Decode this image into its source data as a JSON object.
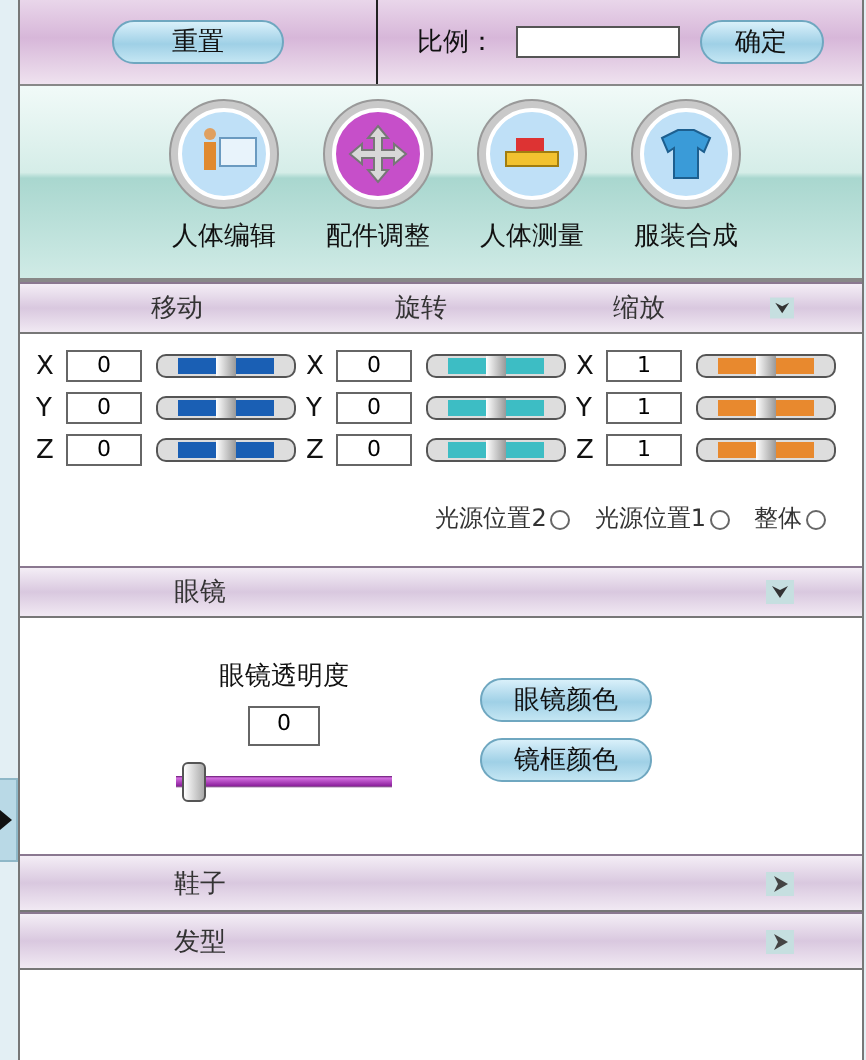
{
  "top_bar": {
    "reset_button": "重置",
    "scale_label": "比例：",
    "confirm_button": "确定"
  },
  "tools": [
    {
      "label": "人体编辑",
      "kind": "person",
      "selected": false
    },
    {
      "label": "配件调整",
      "kind": "move",
      "selected": true
    },
    {
      "label": "人体测量",
      "kind": "ruler",
      "selected": false
    },
    {
      "label": "服装合成",
      "kind": "shirt",
      "selected": false
    }
  ],
  "transform": {
    "expanded": true,
    "groups": [
      {
        "title": "移动",
        "color": "#1a5fb4",
        "axes": [
          {
            "axis": "X",
            "value": "0",
            "level": 0.5
          },
          {
            "axis": "Y",
            "value": "0",
            "level": 0.5
          },
          {
            "axis": "Z",
            "value": "0",
            "level": 0.5
          }
        ]
      },
      {
        "title": "旋转",
        "color": "#3dbdc4",
        "axes": [
          {
            "axis": "X",
            "value": "0",
            "level": 0.5
          },
          {
            "axis": "Y",
            "value": "0",
            "level": 0.5
          },
          {
            "axis": "Z",
            "value": "0",
            "level": 0.5
          }
        ]
      },
      {
        "title": "缩放",
        "color": "#e8892e",
        "axes": [
          {
            "axis": "X",
            "value": "1",
            "level": 0.5
          },
          {
            "axis": "Y",
            "value": "1",
            "level": 0.5
          },
          {
            "axis": "Z",
            "value": "1",
            "level": 0.5
          }
        ]
      }
    ],
    "radios": [
      {
        "label": "光源位置2",
        "selected": false
      },
      {
        "label": "光源位置1",
        "selected": false
      },
      {
        "label": "整体",
        "selected": false
      }
    ]
  },
  "glasses": {
    "title": "眼镜",
    "expanded": true,
    "opacity_label": "眼镜透明度",
    "opacity_value": "0",
    "level": 0.08,
    "buttons": [
      "眼镜颜色",
      "镜框颜色"
    ]
  },
  "sections": [
    {
      "title": "鞋子",
      "expanded": false
    },
    {
      "title": "发型",
      "expanded": false
    }
  ]
}
